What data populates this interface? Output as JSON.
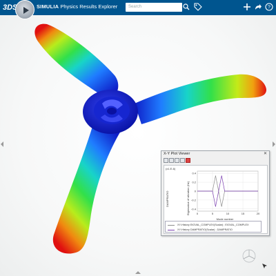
{
  "header": {
    "brand": "SIMULIA",
    "title": "Physics Results Explorer",
    "search_placeholder": "Search",
    "brand_color": "#00558f"
  },
  "icons": [
    "3ds-logo-icon",
    "compass-icon",
    "search-icon",
    "tag-icon",
    "plus-icon",
    "share-icon",
    "help-icon"
  ],
  "plot_viewer": {
    "title": "X-Y Plot Viewer",
    "close": "✕",
    "toolbar_icons": [
      "select-icon",
      "fit-icon",
      "grid-icon",
      "zoom-icon",
      "delete-icon"
    ],
    "scale_label": "(x1.E-6)",
    "y_left_label": "DAMPRATIO",
    "y_right_label": "Eigenvalue of vibration (Hz)",
    "x_label": "Mode number",
    "x_ticks": [
      "0",
      "5",
      "10",
      "15",
      "20"
    ],
    "y_ticks": [
      "0.4",
      "0.2",
      "0",
      "-0.2",
      "-0.4"
    ],
    "legend": [
      {
        "label": "XY-History EIGVAL_COMPLEX(Scalar) ; EIGVAL_COMPLEX",
        "color": "#8c8c8c"
      },
      {
        "label": "XY-History DAMPRATIO(Scalar) ; DAMPRATIO",
        "color": "#7b3fb0"
      }
    ]
  },
  "chart_data": {
    "type": "line",
    "x_label": "Mode number",
    "ylim": [
      -0.45,
      0.45
    ],
    "xlim": [
      0,
      20
    ],
    "series": [
      {
        "name": "XY-History EIGVAL_COMPLEX(Scalar) ; EIGVAL_COMPLEX",
        "x": [
          0,
          5,
          6,
          7,
          8,
          9,
          20
        ],
        "y": [
          0,
          0,
          0.35,
          0,
          -0.35,
          0,
          0
        ]
      },
      {
        "name": "XY-History DAMPRATIO(Scalar) ; DAMPRATIO",
        "x": [
          0,
          5,
          6,
          7,
          8,
          9,
          20
        ],
        "y": [
          0,
          0,
          -0.35,
          0,
          0.35,
          0,
          0
        ]
      }
    ]
  }
}
